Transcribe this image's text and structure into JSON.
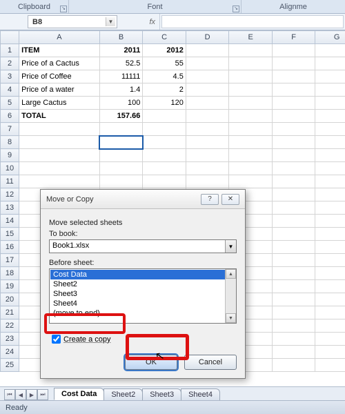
{
  "ribbon": {
    "group_clipboard": "Clipboard",
    "group_font": "Font",
    "group_align": "Alignme"
  },
  "namebox": {
    "value": "B8"
  },
  "fx": {
    "label": "fx"
  },
  "columns": [
    "A",
    "B",
    "C",
    "D",
    "E",
    "F",
    "G"
  ],
  "rows": [
    {
      "n": "1",
      "a": "ITEM",
      "b": "2011",
      "c": "2012",
      "bold": true
    },
    {
      "n": "2",
      "a": "Price of a Cactus",
      "b": "52.5",
      "c": "55"
    },
    {
      "n": "3",
      "a": "Price of Coffee",
      "b": "11111",
      "c": "4.5"
    },
    {
      "n": "4",
      "a": "Price of a water",
      "b": "1.4",
      "c": "2"
    },
    {
      "n": "5",
      "a": "Large Cactus",
      "b": "100",
      "c": "120"
    },
    {
      "n": "6",
      "a": "TOTAL",
      "b": "157.66",
      "c": "",
      "bold": true
    },
    {
      "n": "7"
    },
    {
      "n": "8"
    },
    {
      "n": "9"
    },
    {
      "n": "10"
    },
    {
      "n": "11"
    },
    {
      "n": "12"
    },
    {
      "n": "13"
    },
    {
      "n": "14"
    },
    {
      "n": "15"
    },
    {
      "n": "16"
    },
    {
      "n": "17"
    },
    {
      "n": "18"
    },
    {
      "n": "19"
    },
    {
      "n": "20"
    },
    {
      "n": "21"
    },
    {
      "n": "22"
    },
    {
      "n": "23"
    },
    {
      "n": "24"
    },
    {
      "n": "25"
    }
  ],
  "dialog": {
    "title": "Move or Copy",
    "label_move": "Move selected sheets",
    "label_tobook": "To book:",
    "tobook_value": "Book1.xlsx",
    "label_before": "Before sheet:",
    "sheets": {
      "s0": "Cost Data",
      "s1": "Sheet2",
      "s2": "Sheet3",
      "s3": "Sheet4",
      "s4": "(move to end)"
    },
    "create_copy": "Create a copy",
    "ok": "OK",
    "cancel": "Cancel"
  },
  "tabs": {
    "t0": "Cost Data",
    "t1": "Sheet2",
    "t2": "Sheet3",
    "t3": "Sheet4"
  },
  "status": {
    "ready": "Ready"
  }
}
